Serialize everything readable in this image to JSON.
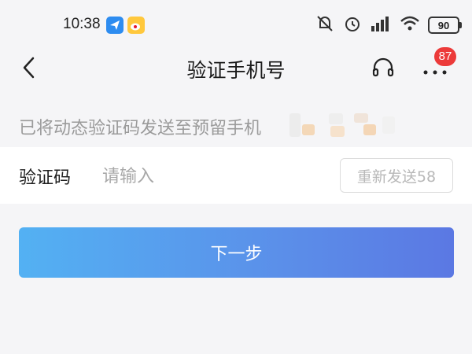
{
  "status_bar": {
    "time": "10:38",
    "battery": "90",
    "icons": [
      "paper-plane-app-icon",
      "weibo-app-icon",
      "mute-icon",
      "alarm-icon",
      "signal-icon",
      "wifi-icon",
      "battery-icon"
    ]
  },
  "nav": {
    "title": "验证手机号",
    "badge_count": "87"
  },
  "notice": {
    "text": "已将动态验证码发送至预留手机"
  },
  "code_row": {
    "label": "验证码",
    "placeholder": "请输入",
    "value": "",
    "resend_label": "重新发送58"
  },
  "actions": {
    "next_label": "下一步"
  },
  "colors": {
    "background": "#f5f5f7",
    "button_gradient_start": "#53b1f3",
    "button_gradient_end": "#5b78e3",
    "badge": "#ec3a3a"
  }
}
